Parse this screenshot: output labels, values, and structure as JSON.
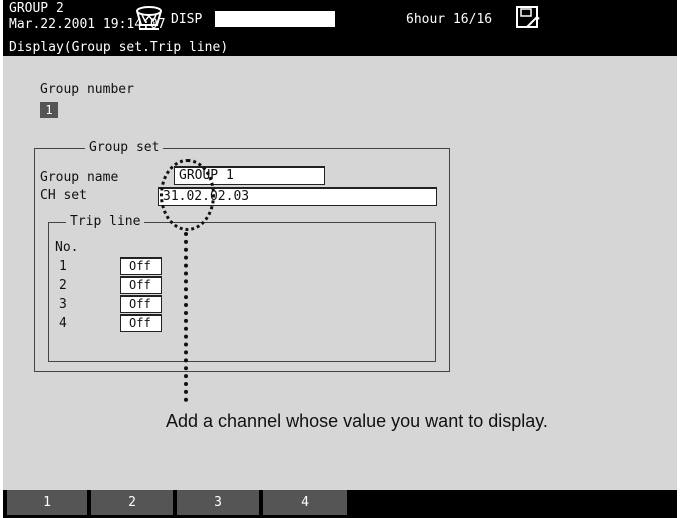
{
  "status_bar": {
    "group": "GROUP 2",
    "datetime": "Mar.22.2001 19:14:07",
    "disp_label": "DISP",
    "time_info": "6hour 16/16"
  },
  "title": "Display(Group set.Trip line)",
  "group_number": {
    "label": "Group number",
    "value": "1"
  },
  "group_set": {
    "legend": "Group set",
    "group_name_label": "Group name",
    "group_name_value": "GROUP 1",
    "ch_set_label": "CH set",
    "ch_set_value": "31.02.02.03"
  },
  "trip_line": {
    "legend": "Trip line",
    "no_header": "No.",
    "rows": [
      {
        "no": "1",
        "value": "Off"
      },
      {
        "no": "2",
        "value": "Off"
      },
      {
        "no": "3",
        "value": "Off"
      },
      {
        "no": "4",
        "value": "Off"
      }
    ]
  },
  "annotation": "Add a channel whose value you want to display.",
  "softkeys": [
    "1",
    "2",
    "3",
    "4"
  ],
  "colors": {
    "screen_bg": "#000000",
    "panel_bg": "#d6d6d6",
    "softkey_bg": "#555555"
  }
}
